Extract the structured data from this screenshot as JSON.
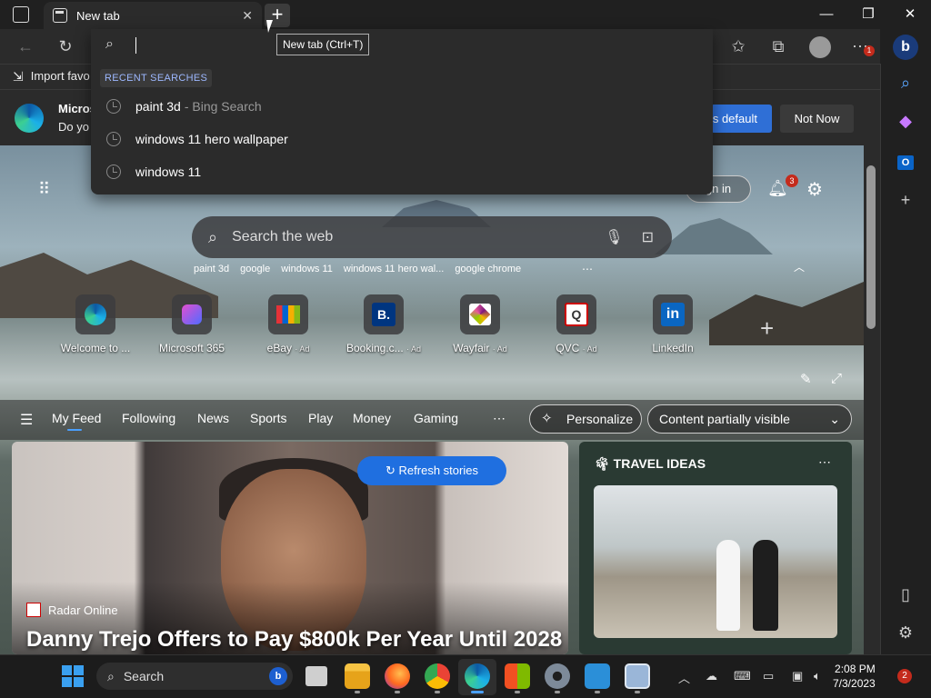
{
  "titlebar": {
    "tab_title": "New tab",
    "tooltip": "New tab (Ctrl+T)"
  },
  "toolbar": {
    "menu_badge": "1"
  },
  "dropdown": {
    "recent_label": "RECENT SEARCHES",
    "items": [
      {
        "query": "paint 3d",
        "suffix": "- Bing Search"
      },
      {
        "query": "windows 11 hero wallpaper",
        "suffix": ""
      },
      {
        "query": "windows 11",
        "suffix": ""
      }
    ]
  },
  "favbar": {
    "import_label": "Import favo"
  },
  "infobar": {
    "line1": "Micros",
    "line2": "Do yo",
    "set_default_label": "s default",
    "not_now_label": "Not Now"
  },
  "page": {
    "sign_in_label": "gn in",
    "bell_badge": "3",
    "search_placeholder": "Search the web",
    "trending": [
      "paint 3d",
      "google",
      "windows 11",
      "windows 11 hero wal...",
      "google chrome"
    ],
    "tiles": [
      {
        "label": "Welcome to ...",
        "ad": ""
      },
      {
        "label": "Microsoft 365",
        "ad": ""
      },
      {
        "label": "eBay",
        "ad": "· Ad"
      },
      {
        "label": "Booking.c...",
        "ad": "· Ad"
      },
      {
        "label": "Wayfair",
        "ad": "· Ad"
      },
      {
        "label": "QVC",
        "ad": "· Ad"
      },
      {
        "label": "LinkedIn",
        "ad": ""
      }
    ],
    "feed_nav": [
      "My Feed",
      "Following",
      "News",
      "Sports",
      "Play",
      "Money",
      "Gaming"
    ],
    "personalize_label": "Personalize",
    "content_visibility": "Content partially visible",
    "refresh_label": "Refresh stories",
    "story": {
      "source": "Radar Online",
      "headline": "Danny Trejo Offers to Pay $800k Per Year Until 2028"
    },
    "travel_title": "TRAVEL IDEAS"
  },
  "taskbar": {
    "search_label": "Search",
    "time": "2:08 PM",
    "date": "7/3/2023",
    "notifications": "2"
  }
}
